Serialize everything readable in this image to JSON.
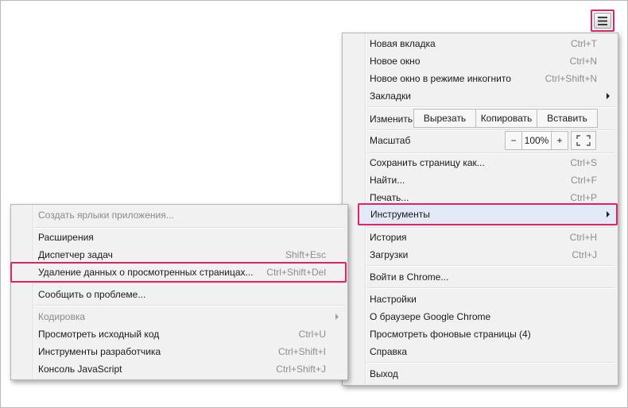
{
  "menu_button": {
    "icon": "hamburger-icon"
  },
  "main_menu": {
    "new_tab": {
      "label": "Новая вкладка",
      "shortcut": "Ctrl+T"
    },
    "new_window": {
      "label": "Новое окно",
      "shortcut": "Ctrl+N"
    },
    "incognito": {
      "label": "Новое окно в режиме инкогнито",
      "shortcut": "Ctrl+Shift+N"
    },
    "bookmarks": {
      "label": "Закладки"
    },
    "edit": {
      "label": "Изменить",
      "cut": "Вырезать",
      "copy": "Копировать",
      "paste": "Вставить"
    },
    "zoom": {
      "label": "Масштаб",
      "minus": "−",
      "value": "100%",
      "plus": "+"
    },
    "save_page": {
      "label": "Сохранить страницу как...",
      "shortcut": "Ctrl+S"
    },
    "find": {
      "label": "Найти...",
      "shortcut": "Ctrl+F"
    },
    "print": {
      "label": "Печать...",
      "shortcut": "Ctrl+P"
    },
    "tools": {
      "label": "Инструменты"
    },
    "history": {
      "label": "История",
      "shortcut": "Ctrl+H"
    },
    "downloads": {
      "label": "Загрузки",
      "shortcut": "Ctrl+J"
    },
    "sign_in": {
      "label": "Войти в Chrome..."
    },
    "settings": {
      "label": "Настройки"
    },
    "about": {
      "label": "О браузере Google Chrome"
    },
    "background_pages": {
      "label": "Просмотреть фоновые страницы (4)"
    },
    "help": {
      "label": "Справка"
    },
    "exit": {
      "label": "Выход"
    }
  },
  "tools_menu": {
    "create_shortcuts": {
      "label": "Создать ярлыки приложения..."
    },
    "extensions": {
      "label": "Расширения"
    },
    "task_manager": {
      "label": "Диспетчер задач",
      "shortcut": "Shift+Esc"
    },
    "clear_data": {
      "label": "Удаление данных о просмотренных страницах...",
      "shortcut": "Ctrl+Shift+Del"
    },
    "report_issue": {
      "label": "Сообщить о проблеме..."
    },
    "encoding": {
      "label": "Кодировка"
    },
    "view_source": {
      "label": "Просмотреть исходный код",
      "shortcut": "Ctrl+U"
    },
    "dev_tools": {
      "label": "Инструменты разработчика",
      "shortcut": "Ctrl+Shift+I"
    },
    "js_console": {
      "label": "Консоль JavaScript",
      "shortcut": "Ctrl+Shift+J"
    }
  },
  "colors": {
    "highlight_border": "#e0245e",
    "menu_bg": "#f1f1f1",
    "hover_bg": "#e3e9f7"
  }
}
